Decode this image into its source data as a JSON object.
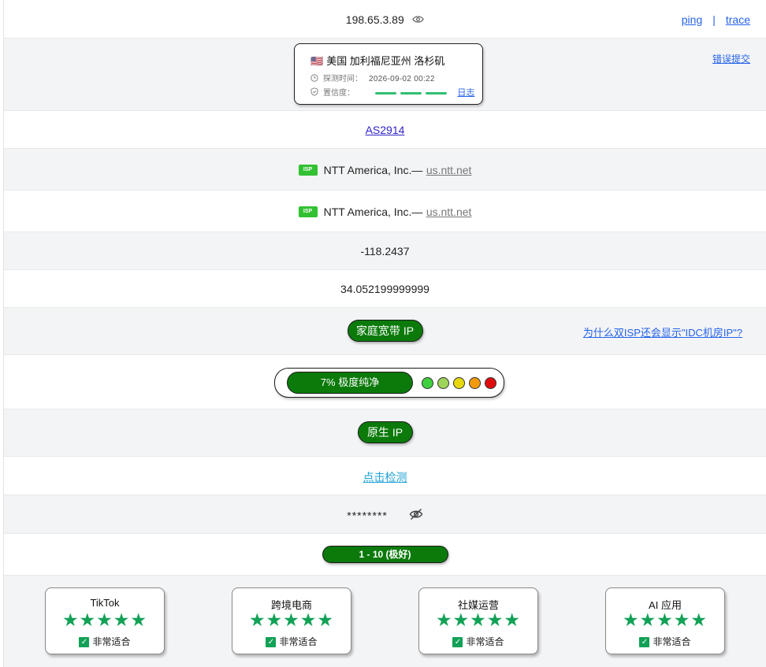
{
  "ip_row": {
    "ip": "198.65.3.89",
    "ping_label": "ping",
    "separator": "|",
    "trace_label": "trace"
  },
  "location": {
    "flag": "🇺🇸",
    "place": "美国 加利福尼亚州 洛杉矶",
    "detect_label": "探测时间：",
    "detect_time": "2026-09-02 00:22",
    "confidence_label": "置信度：",
    "confidence_level": 3,
    "log_label": "日志",
    "report_label": "错误提交"
  },
  "asn": {
    "label": "AS2914"
  },
  "isp_rows": [
    {
      "badge": "ISP",
      "name": "NTT America, Inc.—",
      "domain": "us.ntt.net"
    },
    {
      "badge": "ISP",
      "name": "NTT America, Inc.—",
      "domain": "us.ntt.net"
    }
  ],
  "longitude": "-118.2437",
  "latitude": "34.052199999999",
  "ip_type": {
    "label": "家庭宽带 IP",
    "why_link": "为什么双ISP还会显示\"IDC机房IP\"?"
  },
  "fraud_score": {
    "label": "7%   极度纯净",
    "percent": 7,
    "scale_colors": [
      "#3fcf3f",
      "#9fd45a",
      "#e6d80d",
      "#f29a0c",
      "#e00d0d"
    ]
  },
  "native": {
    "label": "原生 IP"
  },
  "check": {
    "label": "点击检测"
  },
  "masked": {
    "value": "********"
  },
  "rating": {
    "label": "1 - 10 (极好)"
  },
  "use_cases": [
    {
      "title": "TikTok",
      "stars": "★★★★★",
      "verdict": "非常适合"
    },
    {
      "title": "跨境电商",
      "stars": "★★★★★",
      "verdict": "非常适合"
    },
    {
      "title": "社媒运营",
      "stars": "★★★★★",
      "verdict": "非常适合"
    },
    {
      "title": "AI 应用",
      "stars": "★★★★★",
      "verdict": "非常适合"
    }
  ],
  "icons": {
    "eye": "eye-icon",
    "clock": "clock-icon",
    "shield": "shield-icon",
    "eye_off": "eye-off-icon",
    "check": "check-icon",
    "star": "star-icon"
  },
  "colors": {
    "green": "#0b7a0b",
    "link": "#2563eb",
    "star": "#12a156",
    "isp_badge": "#32c132"
  }
}
